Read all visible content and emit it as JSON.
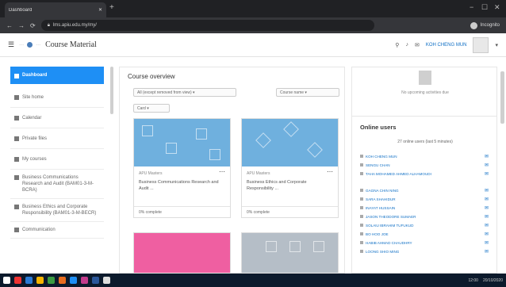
{
  "browser": {
    "tab_title": "Dashboard",
    "tab_close": "✕",
    "new_tab": "+",
    "win_min": "−",
    "win_max": "☐",
    "win_close": "✕",
    "nav_back": "←",
    "nav_forward": "→",
    "nav_reload": "⟳",
    "url": "lms.apiu.edu.my/my/",
    "profile_label": "Incognito"
  },
  "navbar": {
    "menu_icon": "☰",
    "page_title": "Course Material",
    "search_icon": "⚲",
    "bell_icon": "♪",
    "chat_icon": "✉",
    "user_name": "KOH CHENG MUN",
    "user_menu": "▾"
  },
  "sidebar": {
    "items": [
      {
        "label": "Dashboard",
        "active": true
      },
      {
        "label": "Site home"
      },
      {
        "label": "Calendar"
      },
      {
        "label": "Private files"
      },
      {
        "label": "My courses"
      },
      {
        "label": "Business Communications Research and Audit (BAM01-3-M-BCRA)"
      },
      {
        "label": "Business Ethics and Corporate Responsibility (BAM01-3-M-BECR)"
      },
      {
        "label": "Communication"
      }
    ]
  },
  "main": {
    "title": "Course overview",
    "filter_label": "All (except removed from view) ▾",
    "sort_label": "Course name ▾",
    "view_label": "Card ▾",
    "cards": [
      {
        "category": "APU Masters",
        "name": "Business Communications Research and Audit ...",
        "progress": "0% complete",
        "menu": "⋯",
        "style": "blue"
      },
      {
        "category": "APU Masters",
        "name": "Business Ethics and Corporate Responsibility ...",
        "progress": "0% complete",
        "menu": "⋯",
        "style": "blue"
      },
      {
        "category": "",
        "name": "",
        "progress": "",
        "menu": "",
        "style": "pink"
      },
      {
        "category": "",
        "name": "",
        "progress": "",
        "menu": "",
        "style": "grey"
      }
    ]
  },
  "timeline": {
    "empty_text": "No upcoming activities due"
  },
  "online_users": {
    "title": "Online users",
    "subtitle": "27 online users (last 5 minutes)",
    "message_icon": "✉",
    "users": [
      "KOH CHENG MUN",
      "SENGU CHAN",
      "TAHA MOHAMED AHMED ALHAMOUDI",
      "GAGNA CHIN NING",
      "SARA SHAHIDUR",
      "INAYAT HUSSAIN",
      "JASON THEODORE SUMAER",
      "SOLAIU IBRAHIM TUFUKUD",
      "BO HOO JOE",
      "HABIB AHMAD CHAUDHRY",
      "LOONG SHIO MING"
    ]
  },
  "taskbar": {
    "time": "12:00",
    "date": "20/10/2020"
  }
}
